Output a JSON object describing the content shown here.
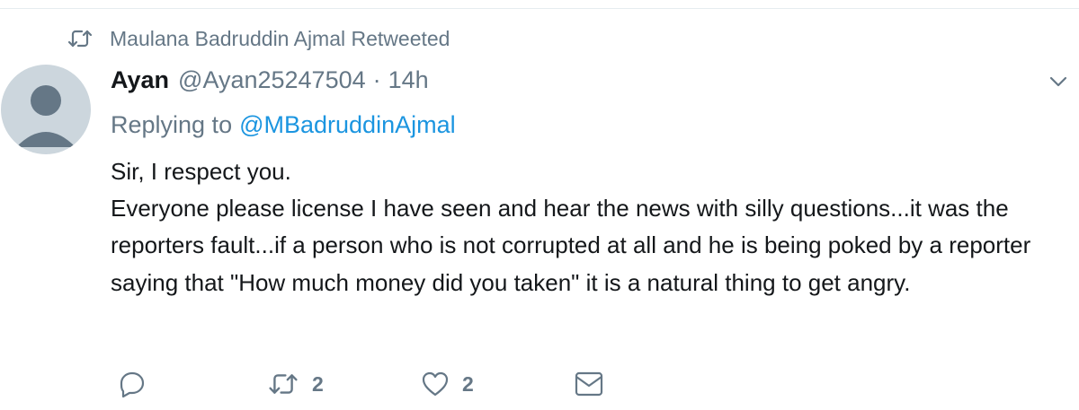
{
  "context": {
    "retweeted_by_text": "Maulana Badruddin Ajmal Retweeted",
    "icon": "retweet-icon"
  },
  "tweet": {
    "fullname": "Ayan",
    "username": "@Ayan25247504",
    "separator": "·",
    "time": "14h",
    "replying_prefix": "Replying to",
    "replying_to": "@MBadruddinAjmal",
    "text_lines": [
      "Sir, I respect you.",
      "Everyone please license I have seen and hear the news with silly questions...it was the reporters fault...if a person who is not corrupted at all and he is being poked by a reporter saying that \"How much money did you taken\" it is a natural thing to get angry."
    ],
    "avatar_icon": "default-avatar-icon",
    "caret_icon": "chevron-down-icon"
  },
  "actions": {
    "reply": {
      "icon": "reply-icon",
      "count": ""
    },
    "retweet": {
      "icon": "retweet-icon",
      "count": "2"
    },
    "like": {
      "icon": "heart-icon",
      "count": "2"
    },
    "dm": {
      "icon": "envelope-icon",
      "count": ""
    }
  },
  "colors": {
    "secondary_text": "#657786",
    "link": "#1b95e0",
    "avatar_bg": "#ccd6dd",
    "avatar_fg": "#657786"
  }
}
